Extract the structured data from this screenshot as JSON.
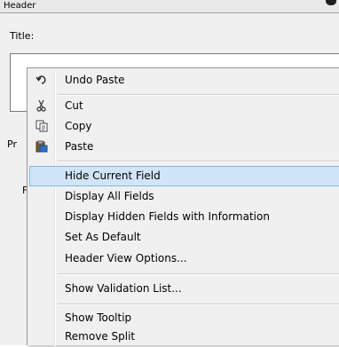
{
  "window": {
    "header_label": "Header",
    "title_label": "Title:"
  },
  "behind": {
    "pr_text": "Pr",
    "f_text": "F"
  },
  "menu": {
    "items": [
      {
        "label": "Undo Paste",
        "icon": "undo-icon"
      },
      {
        "label": "Cut",
        "icon": "scissors-icon"
      },
      {
        "label": "Copy",
        "icon": "copy-icon"
      },
      {
        "label": "Paste",
        "icon": "paste-icon"
      },
      {
        "label": "Hide Current Field",
        "highlighted": true
      },
      {
        "label": "Display All Fields"
      },
      {
        "label": "Display Hidden Fields with Information"
      },
      {
        "label": "Set As Default"
      },
      {
        "label": "Header View Options..."
      },
      {
        "label": "Show Validation List..."
      },
      {
        "label": "Show Tooltip"
      },
      {
        "label": "Remove Split"
      }
    ]
  },
  "colors": {
    "highlight_bg": "#d1e5f8",
    "highlight_border": "#85b7e6",
    "menu_bg": "#f0f0f0"
  }
}
